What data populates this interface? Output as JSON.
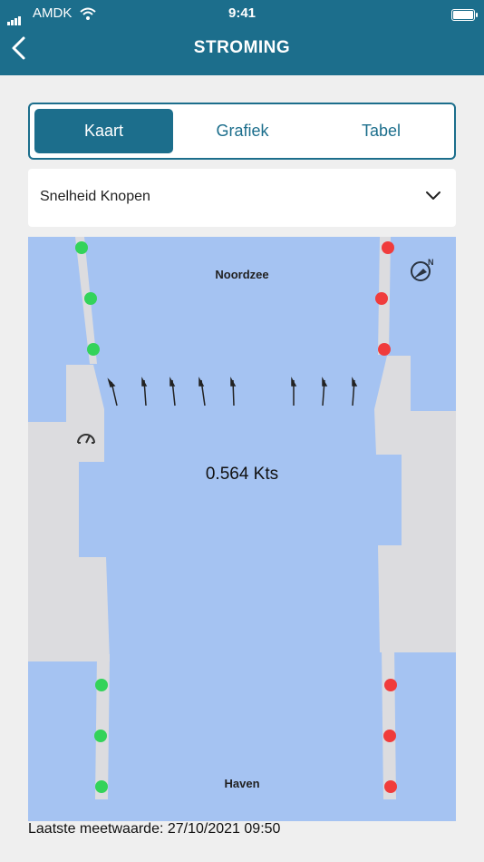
{
  "status_bar": {
    "carrier": "AMDK",
    "time": "9:41"
  },
  "header": {
    "title": "STROMING"
  },
  "tabs": [
    {
      "label": "Kaart",
      "active": true
    },
    {
      "label": "Grafiek",
      "active": false
    },
    {
      "label": "Tabel",
      "active": false
    }
  ],
  "dropdown": {
    "selected": "Snelheid Knopen"
  },
  "map": {
    "top_label": "Noordzee",
    "bottom_label": "Haven",
    "speed": "0.564 Kts",
    "colors": {
      "water": "#a5c3f2",
      "land": "#dcdcdf",
      "green_buoy": "#33d35a",
      "red_buoy": "#f03c3c"
    },
    "icons": [
      "compass-icon",
      "gauge-icon",
      "current-arrow-icon"
    ]
  },
  "footer": {
    "last_measurement": "Laatste meetwaarde: 27/10/2021 09:50"
  },
  "colors": {
    "primary": "#1c6e8c",
    "background": "#efefef"
  }
}
